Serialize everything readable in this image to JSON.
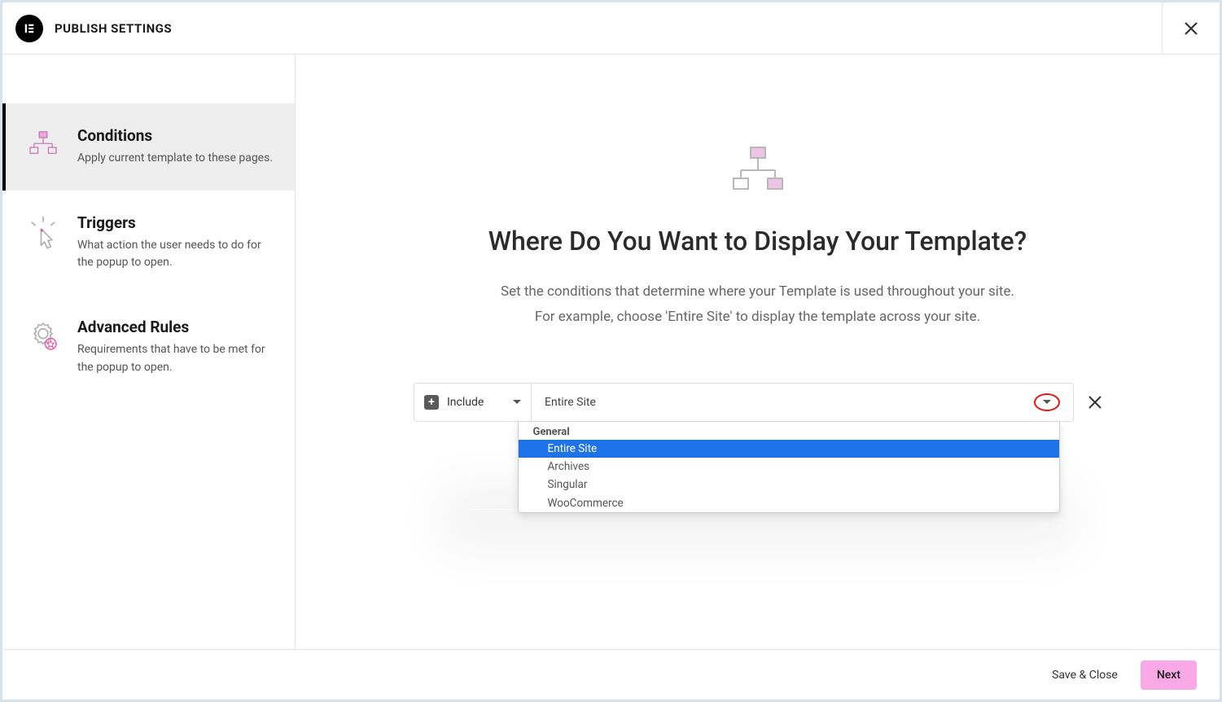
{
  "header": {
    "title": "PUBLISH SETTINGS"
  },
  "sidebar": {
    "tabs": [
      {
        "title": "Conditions",
        "desc": "Apply current template to these pages."
      },
      {
        "title": "Triggers",
        "desc": "What action the user needs to do for the popup to open."
      },
      {
        "title": "Advanced Rules",
        "desc": "Requirements that have to be met for the popup to open."
      }
    ]
  },
  "main": {
    "heading": "Where Do You Want to Display Your Template?",
    "sub_line1": "Set the conditions that determine where your Template is used throughout your site.",
    "sub_line2": "For example, choose 'Entire Site' to display the template across your site.",
    "include_label": "Include",
    "location_label": "Entire Site",
    "dropdown": {
      "group": "General",
      "items": [
        "Entire Site",
        "Archives",
        "Singular",
        "WooCommerce"
      ],
      "selected": "Entire Site"
    }
  },
  "footer": {
    "save_close": "Save & Close",
    "next": "Next"
  }
}
